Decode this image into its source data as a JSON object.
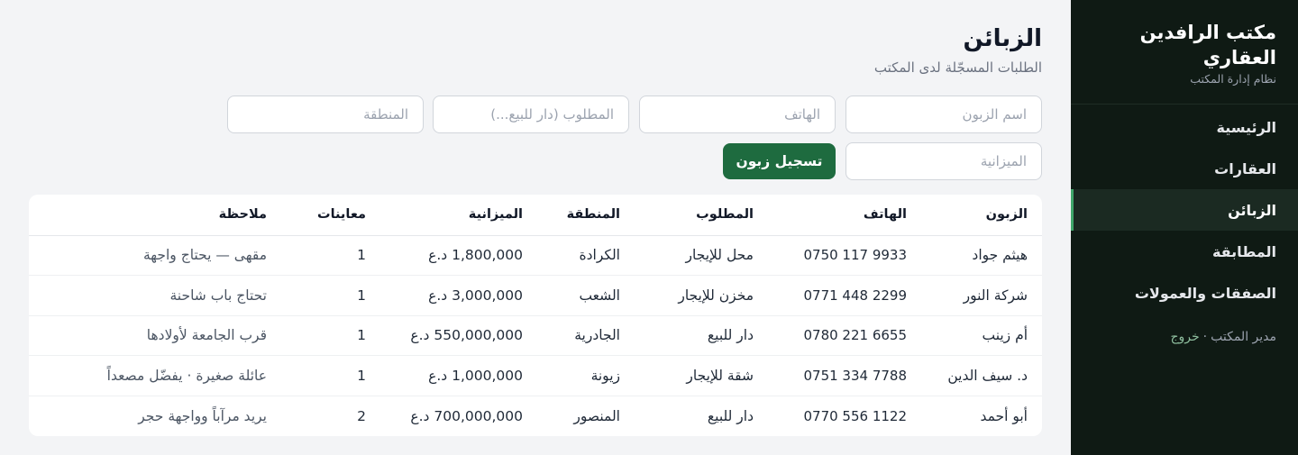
{
  "sidebar": {
    "title": "مكتب الرافدين العقاري",
    "subtitle": "نظام إدارة المكتب",
    "items": [
      {
        "label": "الرئيسية"
      },
      {
        "label": "العقارات"
      },
      {
        "label": "الزبائن"
      },
      {
        "label": "المطابقة"
      },
      {
        "label": "الصفقات والعمولات"
      }
    ],
    "active_item": "الزبائن",
    "user": "مدير المكتب",
    "separator": "·",
    "logout": "خروج"
  },
  "header": {
    "title": "الزبائن",
    "subtitle": "الطلبات المسجّلة لدى المكتب"
  },
  "form": {
    "name_placeholder": "اسم الزبون",
    "phone_placeholder": "الهاتف",
    "wanted_placeholder": "المطلوب (دار للبيع...)",
    "area_placeholder": "المنطقة",
    "budget_placeholder": "الميزانية",
    "submit_label": "تسجيل زبون"
  },
  "table": {
    "headers": {
      "customer": "الزبون",
      "phone": "الهاتف",
      "wanted": "المطلوب",
      "area": "المنطقة",
      "budget": "الميزانية",
      "viewings": "معاينات",
      "note": "ملاحظة"
    },
    "rows": [
      {
        "customer": "هيثم جواد",
        "phone": "0750 117 9933",
        "wanted": "محل للإيجار",
        "area": "الكرادة",
        "budget": "1,800,000 د.ع",
        "viewings": "1",
        "note": "مقهى — يحتاج واجهة"
      },
      {
        "customer": "شركة النور",
        "phone": "0771 448 2299",
        "wanted": "مخزن للإيجار",
        "area": "الشعب",
        "budget": "3,000,000 د.ع",
        "viewings": "1",
        "note": "تحتاج باب شاحنة"
      },
      {
        "customer": "أم زينب",
        "phone": "0780 221 6655",
        "wanted": "دار للبيع",
        "area": "الجادرية",
        "budget": "550,000,000 د.ع",
        "viewings": "1",
        "note": "قرب الجامعة لأولادها"
      },
      {
        "customer": "د. سيف الدين",
        "phone": "0751 334 7788",
        "wanted": "شقة للإيجار",
        "area": "زيونة",
        "budget": "1,000,000 د.ع",
        "viewings": "1",
        "note": "عائلة صغيرة · يفضّل مصعداً"
      },
      {
        "customer": "أبو أحمد",
        "phone": "0770 556 1122",
        "wanted": "دار للبيع",
        "area": "المنصور",
        "budget": "700,000,000 د.ع",
        "viewings": "2",
        "note": "يريد مرآباً وواجهة حجر"
      }
    ]
  },
  "colors": {
    "sidebar_bg": "#0f1a14",
    "active_item_bg": "#1b2a22",
    "primary_button": "#1e6b3f",
    "page_bg": "#f3f4f6"
  }
}
